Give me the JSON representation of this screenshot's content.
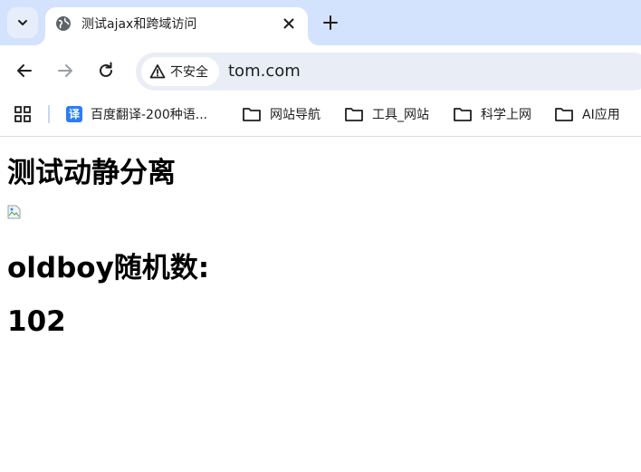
{
  "browser": {
    "tab": {
      "title": "测试ajax和跨域访问",
      "favicon": "globe-icon"
    },
    "address_bar": {
      "security_label": "不安全",
      "url": "tom.com"
    },
    "bookmarks": [
      {
        "label": "百度翻译-200种语...",
        "icon": "baidu-translate-icon"
      },
      {
        "label": "网站导航",
        "icon": "folder-icon"
      },
      {
        "label": "工具_网站",
        "icon": "folder-icon"
      },
      {
        "label": "科学上网",
        "icon": "folder-icon"
      },
      {
        "label": "AI应用",
        "icon": "folder-icon"
      }
    ],
    "colors": {
      "tabstrip": "#d3e3fd",
      "omnibox": "#e9eef6",
      "translate_icon": "#2b7cf6"
    }
  },
  "page": {
    "heading": "测试动静分离",
    "random_label": "oldboy随机数:",
    "random_value": "102"
  }
}
